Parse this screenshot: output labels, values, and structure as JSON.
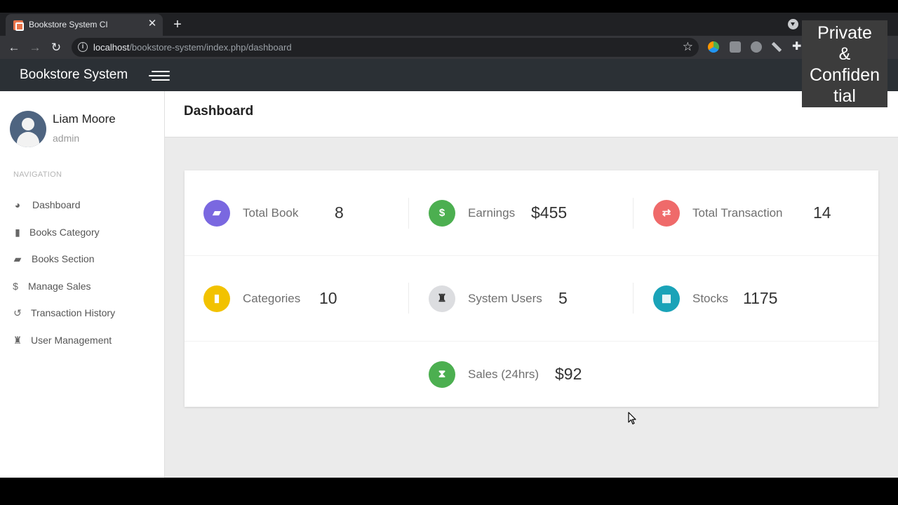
{
  "browser": {
    "tab_title": "Bookstore System CI",
    "tab_close": "✕",
    "new_tab": "+",
    "url_host": "localhost",
    "url_path": "/bookstore-system/index.php/dashboard"
  },
  "app": {
    "brand": "Bookstore System"
  },
  "user": {
    "name": "Liam Moore",
    "role": "admin"
  },
  "sidebar": {
    "heading": "NAVIGATION",
    "items": [
      {
        "label": "Dashboard",
        "icon": "tachometer-icon"
      },
      {
        "label": "Books Category",
        "icon": "bookmark-icon"
      },
      {
        "label": "Books Section",
        "icon": "book-icon"
      },
      {
        "label": "Manage Sales",
        "icon": "dollar-icon"
      },
      {
        "label": "Transaction History",
        "icon": "history-icon"
      },
      {
        "label": "User Management",
        "icon": "user-secret-icon"
      }
    ]
  },
  "page": {
    "title": "Dashboard"
  },
  "stats": [
    {
      "label": "Total Book",
      "value": "8",
      "color": "#7a68e0",
      "icon": "book-icon"
    },
    {
      "label": "Earnings",
      "value": "$455",
      "color": "#4caf50",
      "icon": "dollar-icon"
    },
    {
      "label": "Total Transaction",
      "value": "14",
      "color": "#ef6a6a",
      "icon": "exchange-icon"
    },
    {
      "label": "Categories",
      "value": "10",
      "color": "#f2c200",
      "icon": "bookmark-icon"
    },
    {
      "label": "System Users",
      "value": "5",
      "color": "#dcdde0",
      "icon": "user-secret-icon"
    },
    {
      "label": "Stocks",
      "value": "1175",
      "color": "#1aa3b8",
      "icon": "th-large-icon"
    },
    {
      "label": "Sales (24hrs)",
      "value": "$92",
      "color": "#4caf50",
      "icon": "hourglass-icon"
    }
  ],
  "watermark": {
    "line1": "Private",
    "line2": "&",
    "line3": "Confiden",
    "line4": "tial"
  }
}
